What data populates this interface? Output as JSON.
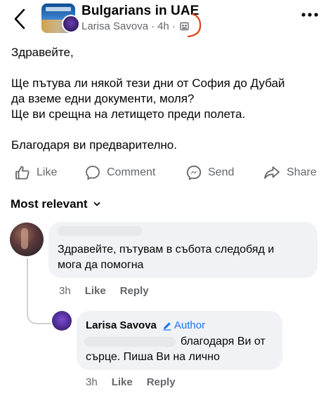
{
  "header": {
    "group_name": "Bulgarians in UAE",
    "author": "Larisa Savova",
    "separator": "·",
    "time": "4h",
    "back_icon": "chevron-left-icon",
    "more_icon": "more-dots-icon"
  },
  "post": {
    "greeting": "Здравейте,",
    "line1": "Ще пътува ли някой тези дни от София до Дубай",
    "line2": "да вземе едни документи, моля?",
    "line3": "Ще ви срещна на летището преди полета.",
    "closing": "Благодаря ви предварително."
  },
  "actions": {
    "like": "Like",
    "comment": "Comment",
    "send": "Send",
    "share": "Share"
  },
  "comments_sort": "Most relevant",
  "comments": [
    {
      "text_line1": "Здравейте, пътувам в събота следобяд и",
      "text_line2": "мога да помогна",
      "time": "3h",
      "like": "Like",
      "reply": "Reply"
    }
  ],
  "reply": {
    "author": "Larisa Savova",
    "badge": "Author",
    "text_line1": "благодаря Ви от",
    "text_line2": "сърце. Пиша Ви на лично",
    "time": "3h",
    "like": "Like",
    "reply": "Reply"
  },
  "colors": {
    "accent": "#1877f2",
    "secondary_text": "#65676b",
    "bubble": "#f0f2f5",
    "annotation": "#e0421b"
  }
}
